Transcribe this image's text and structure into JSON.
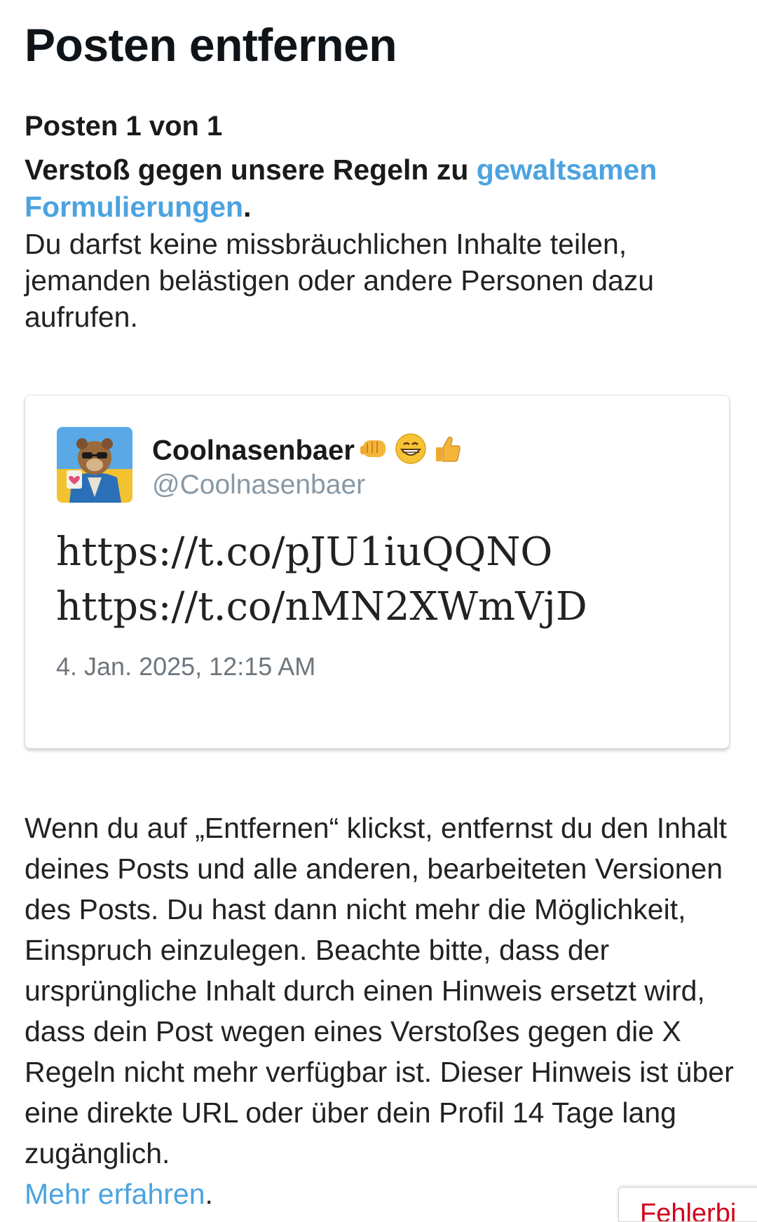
{
  "header": {
    "title": "Posten entfernen"
  },
  "violation": {
    "counter": "Posten 1 von 1",
    "prefix": "Verstoß gegen unsere Regeln zu ",
    "link_text": "gewaltsamen Formulierungen",
    "suffix": ".",
    "description": "Du darfst keine missbräuchlichen Inhalte teilen, jemanden belästigen oder andere Personen dazu aufrufen."
  },
  "post": {
    "display_name": "Coolnasenbaer",
    "emojis": [
      "oncoming-fist-emoji",
      "grinning-face-emoji",
      "thumbs-up-emoji"
    ],
    "handle": "@Coolnasenbaer",
    "lines": [
      "https://t.co/pJU1iuQQNO",
      "https://t.co/nMN2XWmVjD"
    ],
    "timestamp": "4. Jan. 2025, 12:15 AM",
    "avatar": "bear-with-sunglasses-avatar"
  },
  "footer": {
    "text": "Wenn du auf „Entfernen“ klickst, entfernst du den Inhalt deines Posts und alle anderen, bearbeiteten Versionen des Posts. Du hast dann nicht mehr die Möglichkeit, Einspruch einzulegen. Beachte bitte, dass der ursprüngliche Inhalt durch einen Hinweis ersetzt wird, dass dein Post wegen eines Verstoßes gegen die X Regeln nicht mehr verfügbar ist. Dieser Hinweis ist über eine direkte URL oder über dein Profil 14 Tage lang zugänglich.",
    "link_text": "Mehr erfahren",
    "link_suffix": "."
  },
  "error_badge": {
    "label": "Fehlerbi"
  },
  "colors": {
    "link": "#4ca3e0",
    "error": "#d0021b",
    "muted": "#8899a6"
  }
}
